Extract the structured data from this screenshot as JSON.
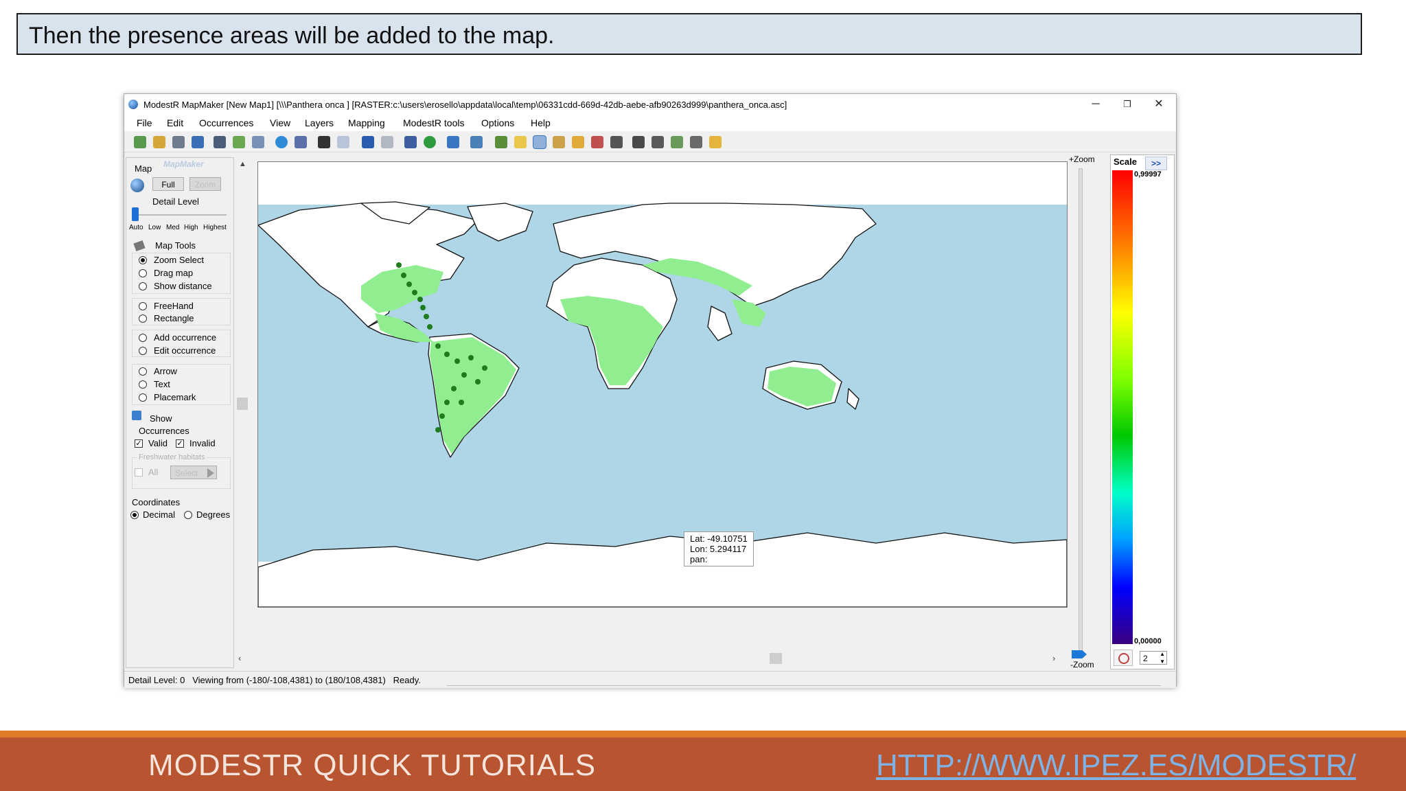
{
  "slide": {
    "caption": "Then the presence areas will be added to the map.",
    "footer_left": "MODESTR QUICK TUTORIALS",
    "footer_link": "HTTP://WWW.IPEZ.ES/MODESTR/"
  },
  "window": {
    "title": "ModestR MapMaker [New Map1] [\\\\\\Panthera onca ] [RASTER:c:\\users\\erosello\\appdata\\local\\temp\\06331cdd-669d-42db-aebe-afb90263d999\\panthera_onca.asc]",
    "controls": {
      "minimize": "─",
      "restore": "❐",
      "close": "✕"
    }
  },
  "menu": [
    "File",
    "Edit",
    "Occurrences",
    "View",
    "Layers",
    "Mapping",
    "ModestR tools",
    "Options",
    "Help"
  ],
  "toolbar_icons": [
    "new-icon",
    "open-icon",
    "import-icon",
    "export-icon",
    "save-icon",
    "print-icon",
    "layers-icon",
    "globe-icon",
    "edit-icon",
    "camera-icon",
    "image-icon",
    "undo-icon",
    "redo-icon",
    "species-icon",
    "world-icon",
    "refresh-icon",
    "grid-icon",
    "filter-icon",
    "tool-icon",
    "select-icon",
    "raster-icon",
    "brush-icon",
    "axis-icon",
    "pin-icon",
    "chart-icon",
    "measure-icon",
    "map-icon",
    "anchor-icon",
    "folder-icon"
  ],
  "left_panel": {
    "map_label": "Map",
    "logo_text": "MapMaker",
    "full_button": "Full",
    "zoom_button": "Zoom",
    "detail_label": "Detail Level",
    "detail_ticks": [
      "Auto",
      "Low",
      "Med",
      "High",
      "Highest"
    ],
    "map_tools_label": "Map Tools",
    "tools": [
      {
        "label": "Zoom Select",
        "selected": true
      },
      {
        "label": "Drag map",
        "selected": false
      },
      {
        "label": "Show distance",
        "selected": false
      },
      {
        "label": "FreeHand",
        "selected": false
      },
      {
        "label": "Rectangle",
        "selected": false
      },
      {
        "label": "Add occurrence",
        "selected": false
      },
      {
        "label": "Edit occurrence",
        "selected": false
      },
      {
        "label": "Arrow",
        "selected": false
      },
      {
        "label": "Text",
        "selected": false
      },
      {
        "label": "Placemark",
        "selected": false
      }
    ],
    "show_label": "Show",
    "occurrences_label": "Occurrences",
    "valid_label": "Valid",
    "invalid_label": "Invalid",
    "freshwater_label": "Freshwater habitats",
    "all_label": "All",
    "select_button": "Select",
    "coordinates_label": "Coordinates",
    "decimal_label": "Decimal",
    "degrees_label": "Degrees"
  },
  "map": {
    "ocean_color": "#aed6e6",
    "land_color": "#ffffff",
    "presence_color": "#90ee90",
    "occurrence_color": "#1e7b1e",
    "tooltip": {
      "lat": "Lat: -49.10751",
      "lon": "Lon: 5.294117",
      "pan": "pan:"
    }
  },
  "zoom": {
    "plus": "+Zoom",
    "minus": "-Zoom"
  },
  "scale": {
    "title": "Scale",
    "expand": ">>",
    "max": "0,99997",
    "min": "0,00000",
    "spin_value": "2"
  },
  "status": "Detail Level: 0   Viewing from (-180/-108,4381) to (180/108,4381)   Ready."
}
